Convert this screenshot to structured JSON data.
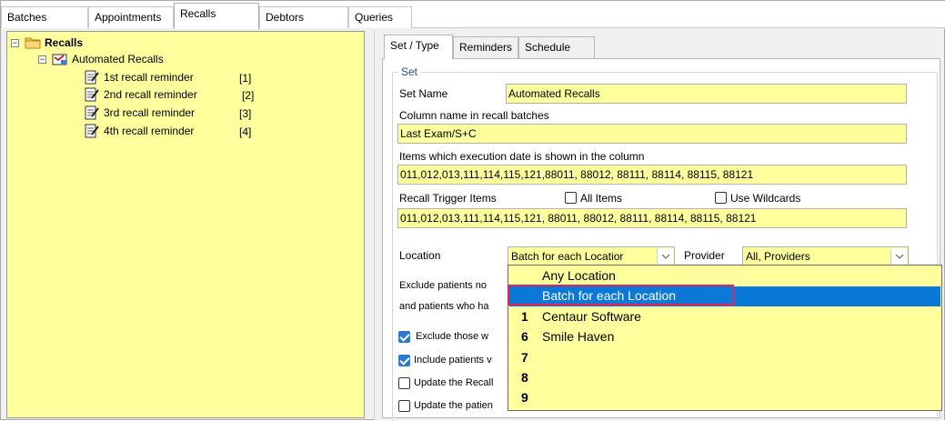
{
  "top_tabs": [
    {
      "label": "Batches"
    },
    {
      "label": "Appointments"
    },
    {
      "label": "Recalls"
    },
    {
      "label": "Debtors"
    },
    {
      "label": "Queries"
    }
  ],
  "tree": {
    "root": {
      "label": "Recalls",
      "expander": "⊟"
    },
    "child": {
      "label": "Automated Recalls",
      "expander": "⊟"
    },
    "items": [
      {
        "label": "1st recall reminder",
        "num": "[1]"
      },
      {
        "label": "2nd recall reminder",
        "num": "[2]"
      },
      {
        "label": "3rd recall reminder",
        "num": "[3]"
      },
      {
        "label": "4th recall reminder",
        "num": "[4]"
      }
    ]
  },
  "sub_tabs": [
    {
      "label": "Set / Type"
    },
    {
      "label": "Reminders"
    },
    {
      "label": "Schedule"
    }
  ],
  "set": {
    "legend": "Set",
    "set_name_label": "Set Name",
    "set_name_value": "Automated Recalls",
    "column_name_label": "Column name in recall batches",
    "column_name_value": "Last Exam/S+C",
    "items_exec_label": "Items which execution date is shown in the column",
    "items_exec_value": "011,012,013,111,114,115,121,88011, 88012, 88111, 88114, 88115, 88121",
    "trigger_label": "Recall Trigger Items",
    "all_items_label": "All Items",
    "use_wildcards_label": "Use Wildcards",
    "trigger_value": "011,012,013,111,114,115,121, 88011, 88012, 88111, 88114, 88115, 88121",
    "location_label": "Location",
    "location_value": "Batch for each Locatior",
    "provider_label": "Provider",
    "provider_value": "All,  Providers",
    "exclude_text_1": "Exclude patients no",
    "exclude_text_2": "and patients who ha",
    "cb_exclude_label": "Exclude those w",
    "cb_include_label": "Include patients v",
    "cb_update_recall_label": "Update the Recall",
    "cb_update_patient_label": "Update the patien"
  },
  "location_dropdown": {
    "options": [
      {
        "num": "",
        "label": "Any Location"
      },
      {
        "num": "",
        "label": "Batch for each Location"
      },
      {
        "num": "1",
        "label": "Centaur Software"
      },
      {
        "num": "6",
        "label": "Smile Haven"
      },
      {
        "num": "7",
        "label": ""
      },
      {
        "num": "8",
        "label": ""
      },
      {
        "num": "9",
        "label": ""
      }
    ],
    "selected_index": 1
  },
  "colors": {
    "field_bg": "#ffff9e",
    "selection": "#0a78d7",
    "highlight_border": "#e0245e",
    "legend": "#1f4e9f"
  }
}
